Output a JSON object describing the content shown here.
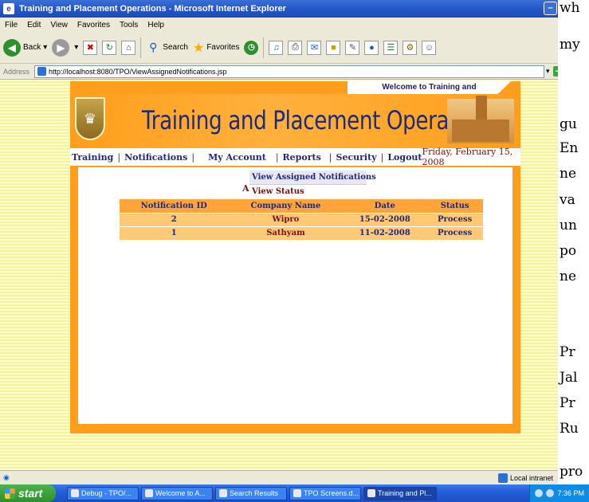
{
  "window": {
    "title": "Training and Placement Operations - Microsoft Internet Explorer",
    "minimize_glyph": "–"
  },
  "menubar": {
    "items": [
      "File",
      "Edit",
      "View",
      "Favorites",
      "Tools",
      "Help"
    ]
  },
  "toolbar": {
    "back_label": "Back",
    "search_label": "Search",
    "favorites_label": "Favorites"
  },
  "addressbar": {
    "label": "Address",
    "url": "http://localhost:8080/TPO/ViewAssignedNotifications.jsp",
    "go_label": "Go"
  },
  "site": {
    "welcome": "Welcome to Training and",
    "title": "Training and Placement Operations",
    "nav": {
      "training": "Training",
      "notifications": "Notifications",
      "my_account": "My Account",
      "reports": "Reports",
      "security": "Security",
      "logout": "Logout",
      "sep": "|",
      "date": "Friday, February 15, 2008"
    },
    "dropdown": {
      "items": [
        "View Assigned Notifications",
        "View Status"
      ],
      "selected_index": 0,
      "behind_letter": "A"
    },
    "table": {
      "columns": [
        "Notification ID",
        "Company Name",
        "Date",
        "Status"
      ],
      "rows": [
        [
          "2",
          "Wipro",
          "15-02-2008",
          "Process"
        ],
        [
          "1",
          "Sathyam",
          "11-02-2008",
          "Process"
        ]
      ]
    }
  },
  "statusbar": {
    "zone": "Local intranet"
  },
  "taskbar": {
    "start_label": "start",
    "tasks": [
      "Debug - TPO/...",
      "Welcome to A...",
      "Search Results",
      "TPO Screens.d...",
      "Training and Pl..."
    ],
    "active_task_index": 4,
    "clock": "7:36 PM"
  },
  "background_doc": {
    "lines": [
      "wh",
      "my",
      "gu",
      "En",
      "ne",
      "va",
      "un",
      "po",
      "ne",
      "Pr",
      "Jal",
      "Pr",
      "Ru",
      "pro"
    ]
  },
  "colors": {
    "site_orange": "#ff9e1b",
    "title_blue": "#1e2a7a",
    "accent_maroon": "#7a1010",
    "xp_blue": "#245edb"
  }
}
